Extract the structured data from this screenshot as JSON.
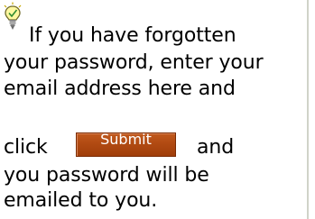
{
  "icon": "lightbulb-hint-icon",
  "help_text": {
    "line1": "If you have forgotten",
    "line2": "your password, enter your",
    "line3": "email address here and",
    "line4_before": "click",
    "line4_after": "and",
    "line5": "you password will be",
    "line6": "emailed to you."
  },
  "submit_button": {
    "label": "Submit",
    "color": "#b14a12"
  }
}
